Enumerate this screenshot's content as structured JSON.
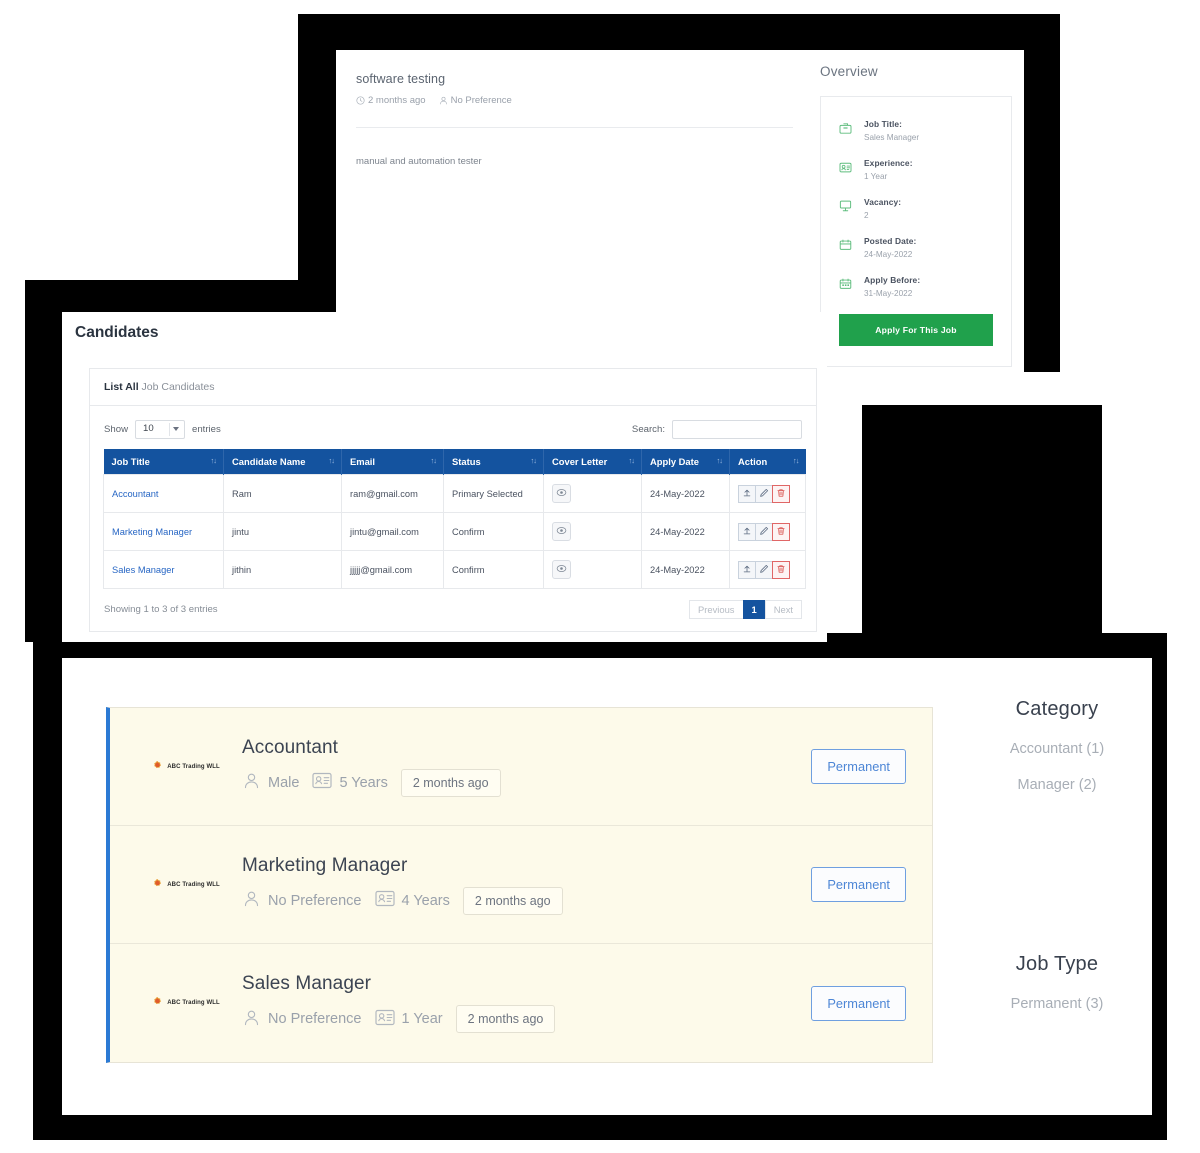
{
  "job_detail": {
    "title": "software testing",
    "meta": [
      {
        "icon": "clock-icon",
        "text": "2 months ago"
      },
      {
        "icon": "user-icon",
        "text": "No Preference"
      }
    ],
    "description": "manual and automation tester",
    "overview": {
      "heading": "Overview",
      "rows": [
        {
          "icon": "briefcase-icon",
          "label": "Job Title:",
          "value": "Sales Manager"
        },
        {
          "icon": "badge-icon",
          "label": "Experience:",
          "value": "1 Year"
        },
        {
          "icon": "monitor-icon",
          "label": "Vacancy:",
          "value": "2"
        },
        {
          "icon": "calendar-icon",
          "label": "Posted Date:",
          "value": "24-May-2022"
        },
        {
          "icon": "calendar-check-icon",
          "label": "Apply Before:",
          "value": "31-May-2022"
        }
      ],
      "apply_label": "Apply For This Job",
      "apply_color": "#20a14c"
    }
  },
  "candidates": {
    "page_title": "Candidates",
    "card_head_strong": "List All",
    "card_head_rest": " Job Candidates",
    "show_label": "Show",
    "show_value": "10",
    "entries_label": "entries",
    "search_label": "Search:",
    "search_value": "",
    "search_placeholder": "",
    "columns": [
      "Job Title",
      "Candidate Name",
      "Email",
      "Status",
      "Cover Letter",
      "Apply Date",
      "Action"
    ],
    "rows": [
      {
        "job_title": "Accountant",
        "candidate_name": "Ram",
        "email": "ram@gmail.com",
        "status": "Primary Selected",
        "cover_letter": "view-icon",
        "apply_date": "24-May-2022"
      },
      {
        "job_title": "Marketing Manager",
        "candidate_name": "jintu",
        "email": "jintu@gmail.com",
        "status": "Confirm",
        "cover_letter": "view-icon",
        "apply_date": "24-May-2022"
      },
      {
        "job_title": "Sales Manager",
        "candidate_name": "jithin",
        "email": "jjjjj@gmail.com",
        "status": "Confirm",
        "cover_letter": "view-icon",
        "apply_date": "24-May-2022"
      }
    ],
    "actions": [
      {
        "icon": "upload-icon",
        "name": "upload-button"
      },
      {
        "icon": "edit-pencil-icon",
        "name": "edit-button"
      },
      {
        "icon": "trash-icon",
        "name": "delete-button"
      }
    ],
    "footer_info": "Showing 1 to 3 of 3 entries",
    "pagination": {
      "previous": "Previous",
      "pages": [
        "1"
      ],
      "next": "Next",
      "active": "1",
      "active_color": "#14539f"
    },
    "header_color": "#14539f",
    "link_color": "#2766c4"
  },
  "job_list": {
    "cards": [
      {
        "logo_text": "ABC Trading WLL",
        "title": "Accountant",
        "gender": "Male",
        "experience": "5 Years",
        "posted_ago": "2 months ago",
        "type_label": "Permanent"
      },
      {
        "logo_text": "ABC Trading WLL",
        "title": "Marketing Manager",
        "gender": "No Preference",
        "experience": "4 Years",
        "posted_ago": "2 months ago",
        "type_label": "Permanent"
      },
      {
        "logo_text": "ABC Trading WLL",
        "title": "Sales Manager",
        "gender": "No Preference",
        "experience": "1 Year",
        "posted_ago": "2 months ago",
        "type_label": "Permanent"
      }
    ],
    "sidebar": {
      "category_heading": "Category",
      "category_items": [
        "Accountant (1)",
        "Manager (2)"
      ],
      "jobtype_heading": "Job Type",
      "jobtype_items": [
        "Permanent (3)"
      ]
    },
    "card_bg": "#fdfaea",
    "accent_color": "#2b7ad4"
  }
}
